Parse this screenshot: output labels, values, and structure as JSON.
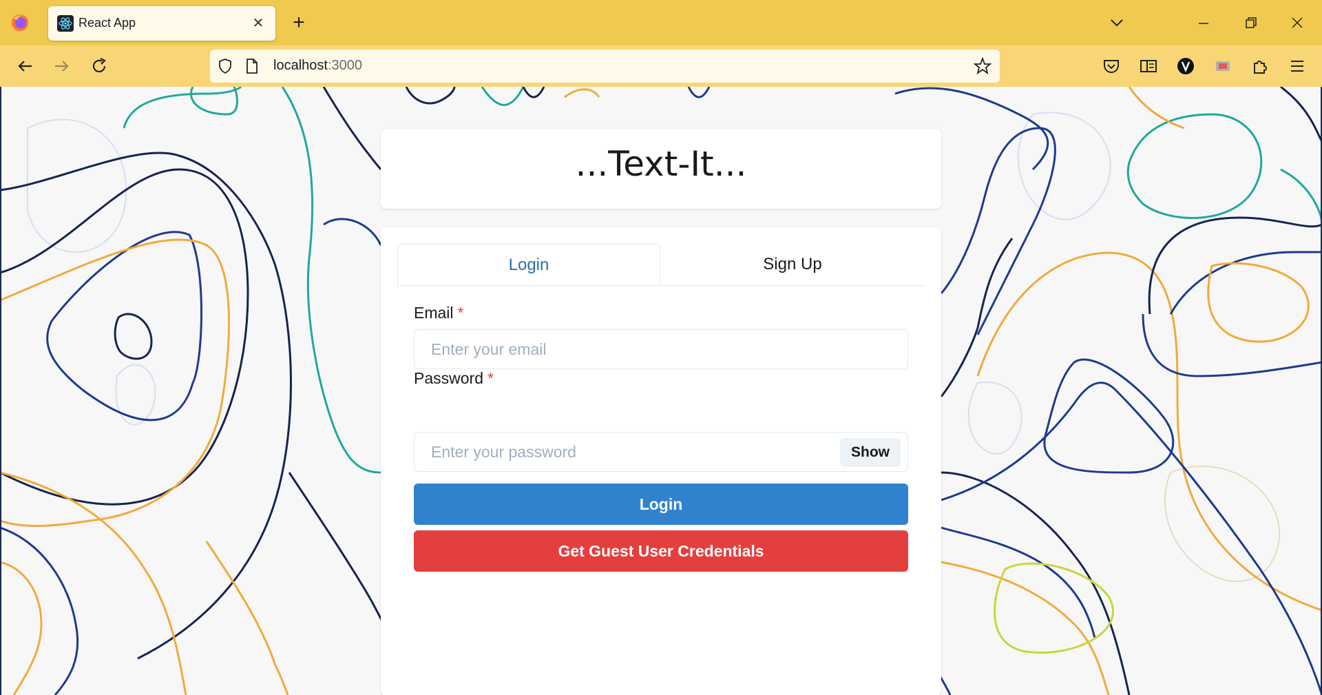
{
  "browser": {
    "tab_title": "React App",
    "new_tab_label": "+",
    "close_tab_label": "✕",
    "url_host": "localhost",
    "url_port": ":3000",
    "accent": "#f0c94f",
    "toolbar_accent": "#f8d675"
  },
  "app": {
    "title": "...Text-It..."
  },
  "auth": {
    "tabs": {
      "login": "Login",
      "signup": "Sign Up"
    },
    "email": {
      "label": "Email",
      "required_mark": "*",
      "placeholder": "Enter your email",
      "value": ""
    },
    "password": {
      "label": "Password",
      "required_mark": "*",
      "placeholder": "Enter your password",
      "value": "",
      "toggle_label": "Show"
    },
    "login_button": "Login",
    "guest_button": "Get Guest User Credentials",
    "colors": {
      "active_tab": "#2b6cb0",
      "login_button": "#3182ce",
      "guest_button": "#e53e3e"
    }
  }
}
